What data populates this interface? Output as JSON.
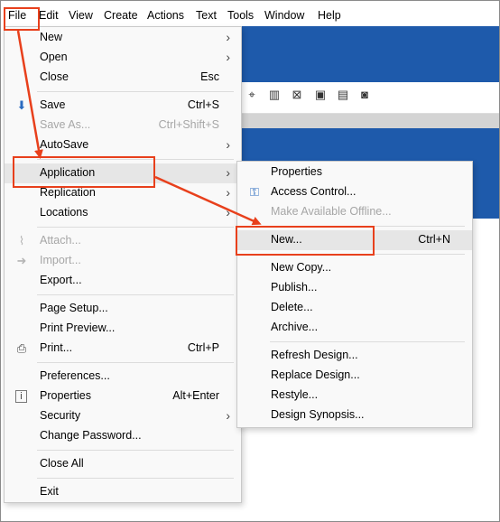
{
  "menubar": {
    "items": [
      "File",
      "Edit",
      "View",
      "Create",
      "Actions",
      "Text",
      "Tools",
      "Window",
      "Help"
    ]
  },
  "file_menu": {
    "items": [
      {
        "label": "New",
        "submenu": true
      },
      {
        "label": "Open",
        "submenu": true
      },
      {
        "label": "Close",
        "shortcut": "Esc"
      },
      {
        "label": "Save",
        "shortcut": "Ctrl+S",
        "icon": "save-icon"
      },
      {
        "label": "Save As...",
        "shortcut": "Ctrl+Shift+S",
        "disabled": true
      },
      {
        "label": "AutoSave",
        "submenu": true
      },
      {
        "label": "Application",
        "submenu": true,
        "highlighted": true
      },
      {
        "label": "Replication",
        "submenu": true
      },
      {
        "label": "Locations",
        "submenu": true
      },
      {
        "label": "Attach...",
        "disabled": true,
        "icon": "paperclip-icon"
      },
      {
        "label": "Import...",
        "disabled": true,
        "icon": "import-icon"
      },
      {
        "label": "Export..."
      },
      {
        "label": "Page Setup..."
      },
      {
        "label": "Print Preview..."
      },
      {
        "label": "Print...",
        "shortcut": "Ctrl+P",
        "icon": "printer-icon"
      },
      {
        "label": "Preferences..."
      },
      {
        "label": "Properties",
        "shortcut": "Alt+Enter",
        "icon": "info-icon"
      },
      {
        "label": "Security",
        "submenu": true
      },
      {
        "label": "Change Password..."
      },
      {
        "label": "Close All"
      },
      {
        "label": "Exit"
      }
    ]
  },
  "application_menu": {
    "items": [
      {
        "label": "Properties"
      },
      {
        "label": "Access Control...",
        "icon": "key-icon"
      },
      {
        "label": "Make Available Offline...",
        "disabled": true
      },
      {
        "label": "New...",
        "shortcut": "Ctrl+N",
        "highlighted": true
      },
      {
        "label": "New Copy..."
      },
      {
        "label": "Publish..."
      },
      {
        "label": "Delete..."
      },
      {
        "label": "Archive..."
      },
      {
        "label": "Refresh Design..."
      },
      {
        "label": "Replace Design..."
      },
      {
        "label": "Restyle..."
      },
      {
        "label": "Design Synopsis..."
      }
    ]
  },
  "colors": {
    "accent_blue": "#1e5aab",
    "annotation_red": "#e8401c",
    "menu_bg": "#f9f9f9",
    "highlight_bg": "#e6e6e6"
  }
}
